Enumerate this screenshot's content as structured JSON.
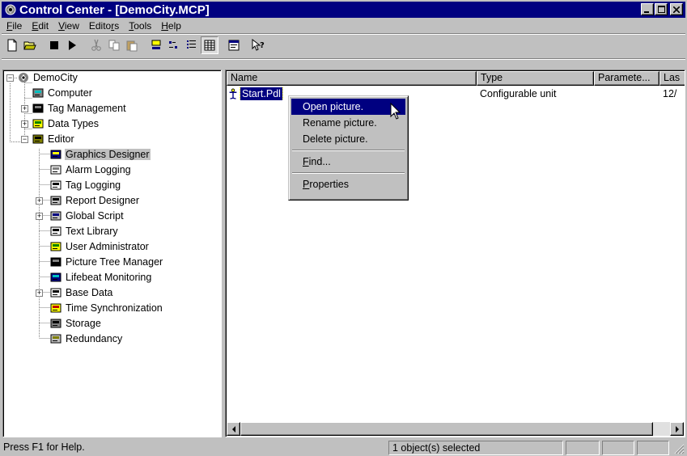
{
  "window": {
    "title": "Control Center - [DemoCity.MCP]",
    "controls": [
      "minimize",
      "maximize",
      "close"
    ]
  },
  "menu": [
    {
      "label": "File",
      "mnemonic": "F"
    },
    {
      "label": "Edit",
      "mnemonic": "E"
    },
    {
      "label": "View",
      "mnemonic": "V"
    },
    {
      "label": "Editors",
      "mnemonic": "r"
    },
    {
      "label": "Tools",
      "mnemonic": "T"
    },
    {
      "label": "Help",
      "mnemonic": "H"
    }
  ],
  "toolbar": {
    "buttons": [
      "new-file-icon",
      "open-folder-icon",
      "stop-icon",
      "play-icon",
      "cut-icon",
      "copy-icon",
      "paste-icon",
      "large-icons-view-icon",
      "small-icons-view-icon",
      "list-view-icon",
      "details-view-icon",
      "properties-icon",
      "context-help-icon"
    ],
    "pressed": "details-view-icon"
  },
  "tree": {
    "root": "DemoCity",
    "items": [
      {
        "label": "Computer",
        "icon": "computer-icon",
        "expander": ""
      },
      {
        "label": "Tag Management",
        "icon": "tag-management-icon",
        "expander": "+"
      },
      {
        "label": "Data Types",
        "icon": "data-types-icon",
        "expander": "+"
      },
      {
        "label": "Editor",
        "icon": "editor-icon",
        "expander": "-"
      },
      {
        "label": "Graphics Designer",
        "icon": "graphics-designer-icon",
        "expander": "",
        "selected": true
      },
      {
        "label": "Alarm Logging",
        "icon": "alarm-logging-icon",
        "expander": ""
      },
      {
        "label": "Tag Logging",
        "icon": "tag-logging-icon",
        "expander": ""
      },
      {
        "label": "Report Designer",
        "icon": "report-designer-icon",
        "expander": "+"
      },
      {
        "label": "Global Script",
        "icon": "global-script-icon",
        "expander": "+"
      },
      {
        "label": "Text Library",
        "icon": "text-library-icon",
        "expander": ""
      },
      {
        "label": "User Administrator",
        "icon": "user-administrator-icon",
        "expander": ""
      },
      {
        "label": "Picture Tree Manager",
        "icon": "picture-tree-icon",
        "expander": ""
      },
      {
        "label": "Lifebeat Monitoring",
        "icon": "lifebeat-icon",
        "expander": ""
      },
      {
        "label": "Base Data",
        "icon": "base-data-icon",
        "expander": "+"
      },
      {
        "label": "Time Synchronization",
        "icon": "time-sync-icon",
        "expander": ""
      },
      {
        "label": "Storage",
        "icon": "storage-icon",
        "expander": ""
      },
      {
        "label": "Redundancy",
        "icon": "redundancy-icon",
        "expander": ""
      }
    ]
  },
  "list": {
    "columns": [
      "Name",
      "Type",
      "Paramete...",
      "Las"
    ],
    "rows": [
      {
        "name": "Start.Pdl",
        "type": "Configurable unit",
        "parameters": "",
        "last": "12/"
      }
    ]
  },
  "context_menu": {
    "items": [
      "Open picture.",
      "Rename picture.",
      "Delete picture.",
      "Find...",
      "Properties"
    ],
    "highlighted": "Open picture."
  },
  "status": {
    "help": "Press F1 for Help.",
    "selection": "1 object(s) selected"
  }
}
